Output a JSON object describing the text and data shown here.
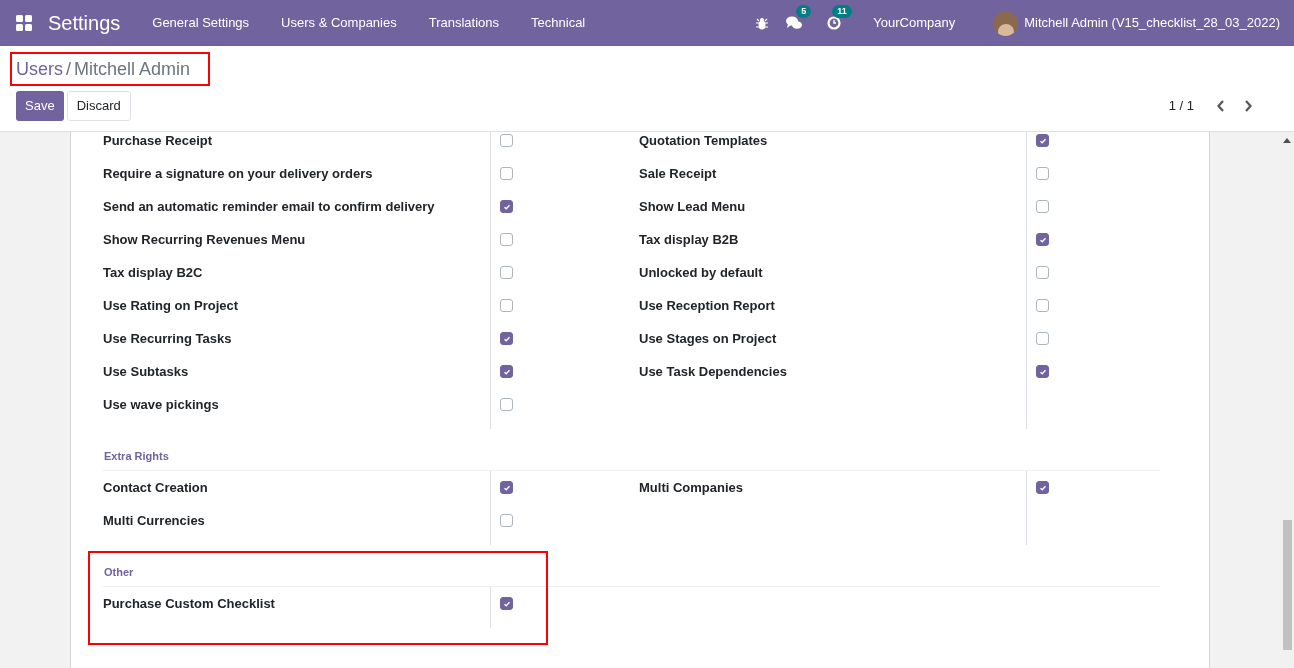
{
  "navbar": {
    "app": "Settings",
    "menus": [
      "General Settings",
      "Users & Companies",
      "Translations",
      "Technical"
    ],
    "messages_count": "5",
    "activities_count": "11",
    "company": "YourCompany",
    "user": "Mitchell Admin (V15_checklist_28_03_2022)"
  },
  "breadcrumb": {
    "items": [
      "Users",
      "Mitchell Admin"
    ],
    "separator": "/",
    "highlighted": true
  },
  "buttons": [
    {
      "label": "Save",
      "kind": "primary"
    },
    {
      "label": "Discard",
      "kind": "secondary"
    }
  ],
  "pager": {
    "value": "1 / 1"
  },
  "sections": [
    {
      "left": [
        {
          "label": "Purchase Receipt",
          "checked": false
        },
        {
          "label": "Require a signature on your delivery orders",
          "checked": false
        },
        {
          "label": "Send an automatic reminder email to confirm delivery",
          "checked": true
        },
        {
          "label": "Show Recurring Revenues Menu",
          "checked": false
        },
        {
          "label": "Tax display B2C",
          "checked": false
        },
        {
          "label": "Use Rating on Project",
          "checked": false
        },
        {
          "label": "Use Recurring Tasks",
          "checked": true
        },
        {
          "label": "Use Subtasks",
          "checked": true
        },
        {
          "label": "Use wave pickings",
          "checked": false
        }
      ],
      "right": [
        {
          "label": "Quotation Templates",
          "checked": true
        },
        {
          "label": "Sale Receipt",
          "checked": false
        },
        {
          "label": "Show Lead Menu",
          "checked": false
        },
        {
          "label": "Tax display B2B",
          "checked": true
        },
        {
          "label": "Unlocked by default",
          "checked": false
        },
        {
          "label": "Use Reception Report",
          "checked": false
        },
        {
          "label": "Use Stages on Project",
          "checked": false
        },
        {
          "label": "Use Task Dependencies",
          "checked": true
        }
      ]
    },
    {
      "title": "Extra Rights",
      "left": [
        {
          "label": "Contact Creation",
          "checked": true
        },
        {
          "label": "Multi Currencies",
          "checked": false
        }
      ],
      "right": [
        {
          "label": "Multi Companies",
          "checked": true
        }
      ]
    },
    {
      "title": "Other",
      "highlighted": true,
      "left": [
        {
          "label": "Purchase Custom Checklist",
          "checked": true
        }
      ]
    }
  ]
}
